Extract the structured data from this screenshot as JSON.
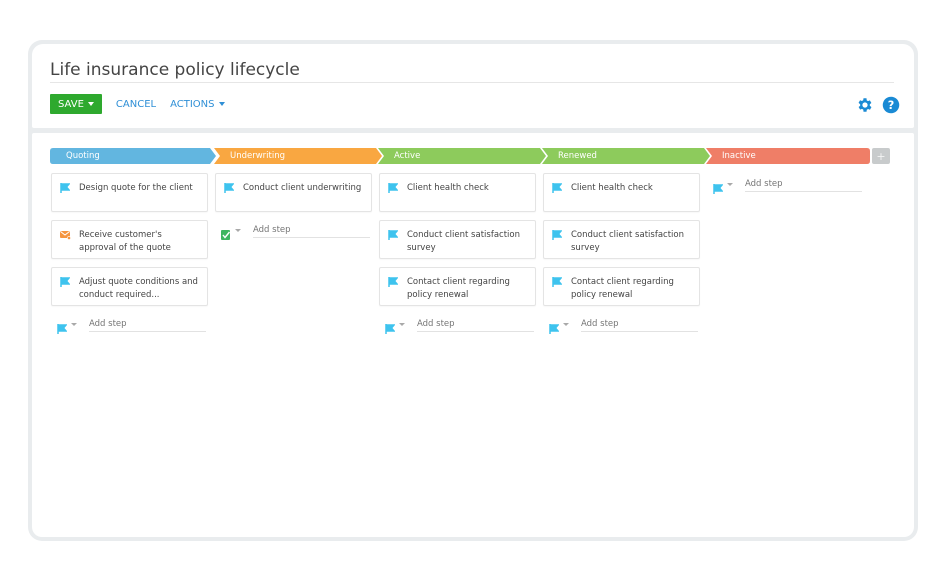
{
  "page": {
    "title": "Life insurance policy lifecycle"
  },
  "toolbar": {
    "save_label": "SAVE",
    "cancel_label": "CANCEL",
    "actions_label": "ACTIONS"
  },
  "header_icons": [
    "gear-icon",
    "help-icon"
  ],
  "add_stage_label": "+",
  "colors": {
    "quoting": "#62b6e0",
    "underwriting": "#f9a741",
    "active": "#8dcb5c",
    "renewed": "#8dcb5c",
    "inactive": "#ef7e67",
    "save": "#2ea92e",
    "link": "#2f8fd6",
    "flag": "#3ec3ee"
  },
  "stages": [
    {
      "name": "Quoting",
      "steps": [
        {
          "icon": "flag-icon",
          "text": "Design quote for the client"
        },
        {
          "icon": "email-icon",
          "text": "Receive customer's approval of the quote"
        },
        {
          "icon": "flag-icon",
          "text": "Adjust quote conditions and conduct required..."
        }
      ],
      "add_icon": "flag-icon",
      "add_placeholder": "Add step"
    },
    {
      "name": "Underwriting",
      "steps": [
        {
          "icon": "flag-icon",
          "text": "Conduct client underwriting"
        }
      ],
      "add_icon": "task-check-icon",
      "add_placeholder": "Add step"
    },
    {
      "name": "Active",
      "steps": [
        {
          "icon": "flag-icon",
          "text": "Client health check"
        },
        {
          "icon": "flag-icon",
          "text": "Conduct client satisfaction survey"
        },
        {
          "icon": "flag-icon",
          "text": "Contact client regarding policy renewal"
        }
      ],
      "add_icon": "flag-icon",
      "add_placeholder": "Add step"
    },
    {
      "name": "Renewed",
      "steps": [
        {
          "icon": "flag-icon",
          "text": "Client health check"
        },
        {
          "icon": "flag-icon",
          "text": "Conduct client satisfaction survey"
        },
        {
          "icon": "flag-icon",
          "text": "Contact client regarding policy renewal"
        }
      ],
      "add_icon": "flag-icon",
      "add_placeholder": "Add step"
    },
    {
      "name": "Inactive",
      "steps": [],
      "add_icon": "flag-icon",
      "add_placeholder": "Add step"
    }
  ]
}
